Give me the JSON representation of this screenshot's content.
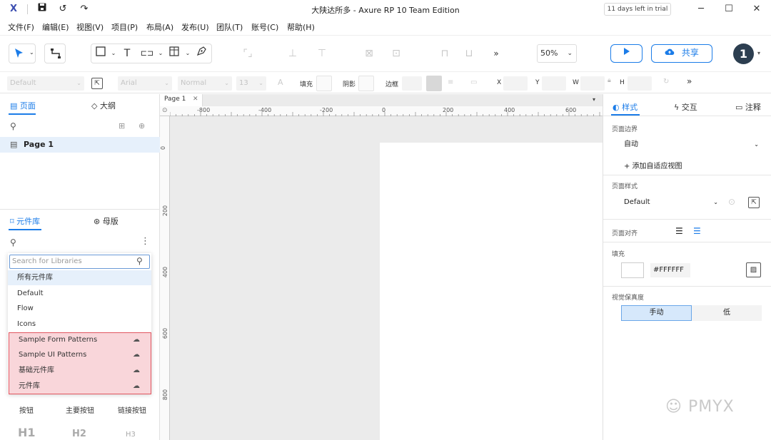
{
  "titlebar": {
    "app_title": "大陕达所多 - Axure RP 10 Team Edition",
    "trial_badge": "11 days left in trial",
    "minimize": "─",
    "maximize": "☐",
    "close": "✕"
  },
  "menu": [
    "文件(F)",
    "编辑(E)",
    "视图(V)",
    "项目(P)",
    "布局(A)",
    "发布(U)",
    "团队(T)",
    "账号(C)",
    "帮助(H)"
  ],
  "toolbar": {
    "zoom": "50%",
    "share_label": "共享",
    "avatar_text": "1"
  },
  "stylebar": {
    "style_select": "Default",
    "font_select": "Arial",
    "weight_select": "Normal",
    "size_select": "13",
    "fill_label": "填充",
    "shadow_label": "阴影",
    "border_label": "边框",
    "x_label": "X",
    "y_label": "Y",
    "w_label": "W",
    "h_label": "H"
  },
  "left": {
    "tab_pages": "页面",
    "tab_outline": "大纲",
    "page_item": "Page 1",
    "tab_libraries": "元件库",
    "tab_masters": "母版",
    "search_placeholder": "Search for Libraries",
    "dropdown_items": [
      "所有元件库",
      "Default",
      "Flow",
      "Icons"
    ],
    "highlighted_items": [
      "Sample Form Patterns",
      "Sample UI Patterns",
      "基础元件库",
      "元件库"
    ],
    "widgets": [
      "按钮",
      "主要按钮",
      "链接按钮"
    ],
    "headings": [
      "H1",
      "H2",
      "H3"
    ]
  },
  "canvas": {
    "page_tab": "Page 1",
    "ruler_top": [
      "-800",
      "-400",
      "-200",
      "0",
      "200",
      "400",
      "600"
    ],
    "ruler_left": [
      "0",
      "200",
      "400",
      "600",
      "800"
    ]
  },
  "right": {
    "tab_style": "样式",
    "tab_interact": "交互",
    "tab_notes": "注释",
    "page_dimension_label": "页面边界",
    "page_dimension_value": "自动",
    "add_adaptive": "+ 添加自适应视图",
    "page_style_label": "页面样式",
    "page_style_value": "Default",
    "page_align_label": "页面对齐",
    "fill_label": "填充",
    "fill_hex": "#FFFFFF",
    "fidelity_label": "视觉保真度",
    "fidelity_manual": "手动",
    "fidelity_low": "低"
  },
  "watermark": "PMYX",
  "colors": {
    "accent": "#1b7ce8",
    "highlight_fill": "#f9d6da",
    "highlight_border": "#e1555f"
  }
}
